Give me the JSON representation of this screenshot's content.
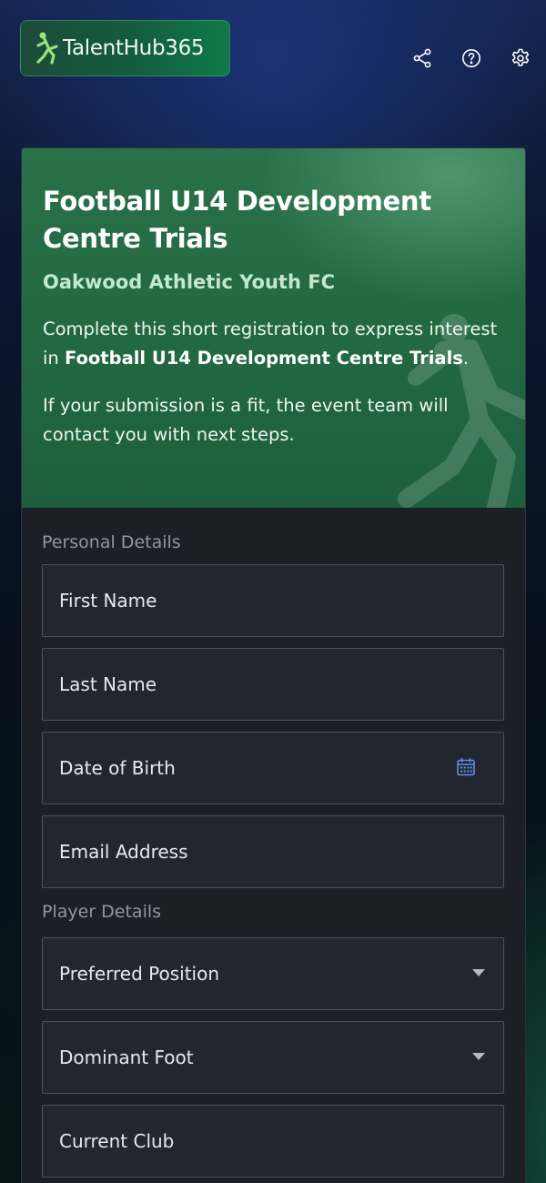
{
  "brand": {
    "name": "TalentHub365"
  },
  "header_icons": [
    "share-icon",
    "help-icon",
    "gear-icon"
  ],
  "colors": {
    "accent_green": "#236a43",
    "subtitle_green": "#c5e7d0",
    "calendar_blue": "#5b8def"
  },
  "hero": {
    "title": "Football U14 Development Centre Trials",
    "subtitle": "Oakwood Athletic Youth FC",
    "intro_before": "Complete this short registration to express interest in ",
    "intro_strong": "Football U14 Development Centre Trials",
    "intro_after": ".",
    "note": "If your submission is a fit, the event team will contact you with next steps."
  },
  "form": {
    "personal_section": "Personal Details",
    "first_name": "First Name",
    "last_name": "Last Name",
    "dob": "Date of Birth",
    "email": "Email Address",
    "player_section": "Player Details",
    "position": "Preferred Position",
    "foot": "Dominant Foot",
    "club": "Current Club"
  }
}
